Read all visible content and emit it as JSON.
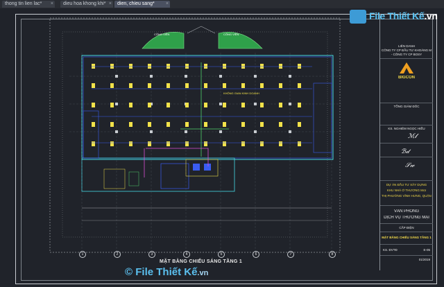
{
  "tabs": [
    {
      "label": "thong tin lien lac*",
      "active": false
    },
    {
      "label": "dieu hoa khong khi*",
      "active": false
    },
    {
      "label": "dien, chieu sang*",
      "active": true
    }
  ],
  "watermark": {
    "brand": "File Thiết Kế",
    "domain_suffix": ".vn"
  },
  "title_block": {
    "owner_label": "LIÊN DANH",
    "owner_line1": "CÔNG TY CP ĐẦU TƯ KHOÁNG MAI",
    "owner_line2": "- CÔNG TY CP BOSY",
    "contractor": "BIGCON",
    "director_label": "TỔNG GIÁM ĐỐC",
    "approve_label": "KS. NGHIÊM NGỌC HIỂU",
    "project_label": "DỰ ÁN ĐẦU TƯ XÂY DỰNG",
    "project_name_1": "KHU NHÀ Ở THƯƠNG MẠI",
    "project_name_2": "THỊ PHƯỜNG VĨNH HƯNG, QUẬN LÊ CHÂN",
    "building_1": "VĂN PHÒNG",
    "building_2": "DỊCH VỤ THƯƠNG MẠI",
    "stage": "CẤP ĐIỆN",
    "sheet_title": "MẶT BẰNG CHIẾU SÁNG TẦNG 1",
    "drawn_by": "KS. ĐVTĐ",
    "sheet_no": "E-05",
    "date": "01/2019"
  },
  "drawing": {
    "title": "MẶT BẰNG CHIẾU SÁNG TẦNG 1",
    "garden_label_left": "CÔNG VIÊN",
    "garden_label_right": "CÔNG VIÊN",
    "hall_label": "KHÔNG GIAN KINH DOANH",
    "grid_axes": [
      "1",
      "2",
      "3",
      "4",
      "5",
      "6",
      "7",
      "8"
    ]
  },
  "colors": {
    "background": "#20232a",
    "lines_white": "#c9cdd2",
    "wall_blue": "#3a5cf0",
    "light_yellow": "#f2e24a",
    "cable_green": "#4fd26a",
    "cable_magenta": "#d94fd6",
    "cyan": "#46d9e6"
  }
}
